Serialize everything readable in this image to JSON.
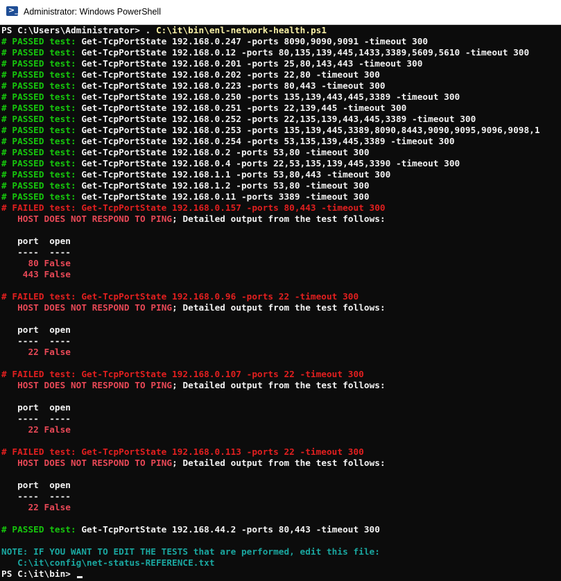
{
  "window": {
    "title": "Administrator: Windows PowerShell"
  },
  "prompt": {
    "path": "PS C:\\Users\\Administrator> ",
    "dot": ". ",
    "script": "C:\\it\\bin\\enl-network-health.ps1"
  },
  "passed": [
    {
      "label": "# PASSED test: ",
      "cmd": "Get-TcpPortState 192.168.0.247 -ports 8090,9090,9091 -timeout 300"
    },
    {
      "label": "# PASSED test: ",
      "cmd": "Get-TcpPortState 192.168.0.12 -ports 80,135,139,445,1433,3389,5609,5610 -timeout 300"
    },
    {
      "label": "# PASSED test: ",
      "cmd": "Get-TcpPortState 192.168.0.201 -ports 25,80,143,443 -timeout 300"
    },
    {
      "label": "# PASSED test: ",
      "cmd": "Get-TcpPortState 192.168.0.202 -ports 22,80 -timeout 300"
    },
    {
      "label": "# PASSED test: ",
      "cmd": "Get-TcpPortState 192.168.0.223 -ports 80,443 -timeout 300"
    },
    {
      "label": "# PASSED test: ",
      "cmd": "Get-TcpPortState 192.168.0.250 -ports 135,139,443,445,3389 -timeout 300"
    },
    {
      "label": "# PASSED test: ",
      "cmd": "Get-TcpPortState 192.168.0.251 -ports 22,139,445 -timeout 300"
    },
    {
      "label": "# PASSED test: ",
      "cmd": "Get-TcpPortState 192.168.0.252 -ports 22,135,139,443,445,3389 -timeout 300"
    },
    {
      "label": "# PASSED test: ",
      "cmd": "Get-TcpPortState 192.168.0.253 -ports 135,139,445,3389,8090,8443,9090,9095,9096,9098,1"
    },
    {
      "label": "# PASSED test: ",
      "cmd": "Get-TcpPortState 192.168.0.254 -ports 53,135,139,445,3389 -timeout 300"
    },
    {
      "label": "# PASSED test: ",
      "cmd": "Get-TcpPortState 192.168.0.2 -ports 53,80 -timeout 300"
    },
    {
      "label": "# PASSED test: ",
      "cmd": "Get-TcpPortState 192.168.0.4 -ports 22,53,135,139,445,3390 -timeout 300"
    },
    {
      "label": "# PASSED test: ",
      "cmd": "Get-TcpPortState 192.168.1.1 -ports 53,80,443 -timeout 300"
    },
    {
      "label": "# PASSED test: ",
      "cmd": "Get-TcpPortState 192.168.1.2 -ports 53,80 -timeout 300"
    },
    {
      "label": "# PASSED test: ",
      "cmd": "Get-TcpPortState 192.168.0.11 -ports 3389 -timeout 300"
    }
  ],
  "failed": [
    {
      "header": "# FAILED test: Get-TcpPortState 192.168.0.157 -ports 80,443 -timeout 300",
      "host": "   HOST ",
      "does": "DOES ",
      "not": "NOT ",
      "respond": "RESPOND ",
      "to": "TO ",
      "ping": "PING",
      "detail": "; Detailed output from the test follows:",
      "col_header": "   port  open",
      "col_sep": "   ----  ----",
      "rows": [
        "     80 False",
        "    443 False"
      ]
    },
    {
      "header": "# FAILED test: Get-TcpPortState 192.168.0.96 -ports 22 -timeout 300",
      "host": "   HOST ",
      "does": "DOES ",
      "not": "NOT ",
      "respond": "RESPOND ",
      "to": "TO ",
      "ping": "PING",
      "detail": "; Detailed output from the test follows:",
      "col_header": "   port  open",
      "col_sep": "   ----  ----",
      "rows": [
        "     22 False"
      ]
    },
    {
      "header": "# FAILED test: Get-TcpPortState 192.168.0.107 -ports 22 -timeout 300",
      "host": "   HOST ",
      "does": "DOES ",
      "not": "NOT ",
      "respond": "RESPOND ",
      "to": "TO ",
      "ping": "PING",
      "detail": "; Detailed output from the test follows:",
      "col_header": "   port  open",
      "col_sep": "   ----  ----",
      "rows": [
        "     22 False"
      ]
    },
    {
      "header": "# FAILED test: Get-TcpPortState 192.168.0.113 -ports 22 -timeout 300",
      "host": "   HOST ",
      "does": "DOES ",
      "not": "NOT ",
      "respond": "RESPOND ",
      "to": "TO ",
      "ping": "PING",
      "detail": "; Detailed output from the test follows:",
      "col_header": "   port  open",
      "col_sep": "   ----  ----",
      "rows": [
        "     22 False"
      ]
    }
  ],
  "last_passed": {
    "label": "# PASSED test: ",
    "cmd": "Get-TcpPortState 192.168.44.2 -ports 80,443 -timeout 300"
  },
  "note": {
    "line1": "NOTE: IF YOU WANT TO EDIT THE TESTS that are performed, edit this file:",
    "line2": "   C:\\it\\config\\net-status-REFERENCE.txt"
  },
  "final_prompt": "PS C:\\it\\bin> ",
  "colors": {
    "passed": "#16c60c",
    "failed": "#e74856",
    "note": "#1aa7a0",
    "text": "#f2f2f2",
    "background": "#0c0c0c"
  },
  "icons": {
    "window": "powershell-icon"
  }
}
